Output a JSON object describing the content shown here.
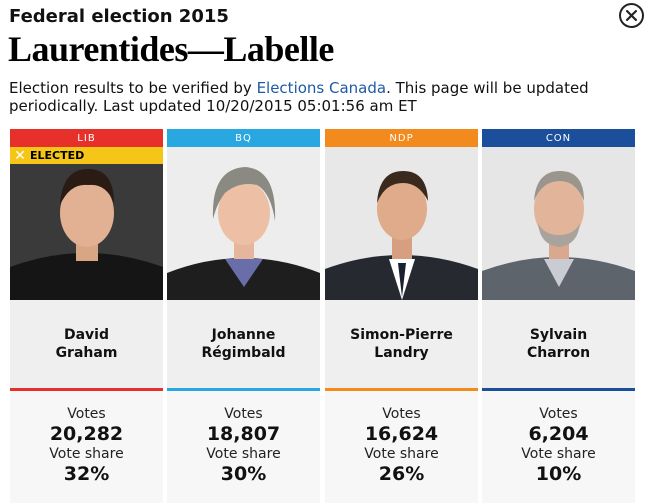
{
  "header": {
    "subtitle": "Federal election 2015",
    "title": "Laurentides—Labelle",
    "note_before": "Election results to be verified by ",
    "note_link": "Elections Canada",
    "note_after": ". This page will be updated periodically. Last updated 10/20/2015 05:01:56 am ET"
  },
  "close_icon": "close-icon",
  "candidates": [
    {
      "party": "LIB",
      "color": "#e8302a",
      "first": "David",
      "last": "Graham",
      "elected_label": "ELECTED",
      "votes_label": "Votes",
      "votes": "20,282",
      "share_label": "Vote share",
      "share": "32%"
    },
    {
      "party": "BQ",
      "color": "#28a7e0",
      "first": "Johanne",
      "last": "Régimbald",
      "votes_label": "Votes",
      "votes": "18,807",
      "share_label": "Vote share",
      "share": "30%"
    },
    {
      "party": "NDP",
      "color": "#f28a1e",
      "first": "Simon-Pierre",
      "last": "Landry",
      "votes_label": "Votes",
      "votes": "16,624",
      "share_label": "Vote share",
      "share": "26%"
    },
    {
      "party": "CON",
      "color": "#1b4f9c",
      "first": "Sylvain",
      "last": "Charron",
      "votes_label": "Votes",
      "votes": "6,204",
      "share_label": "Vote share",
      "share": "10%"
    }
  ]
}
